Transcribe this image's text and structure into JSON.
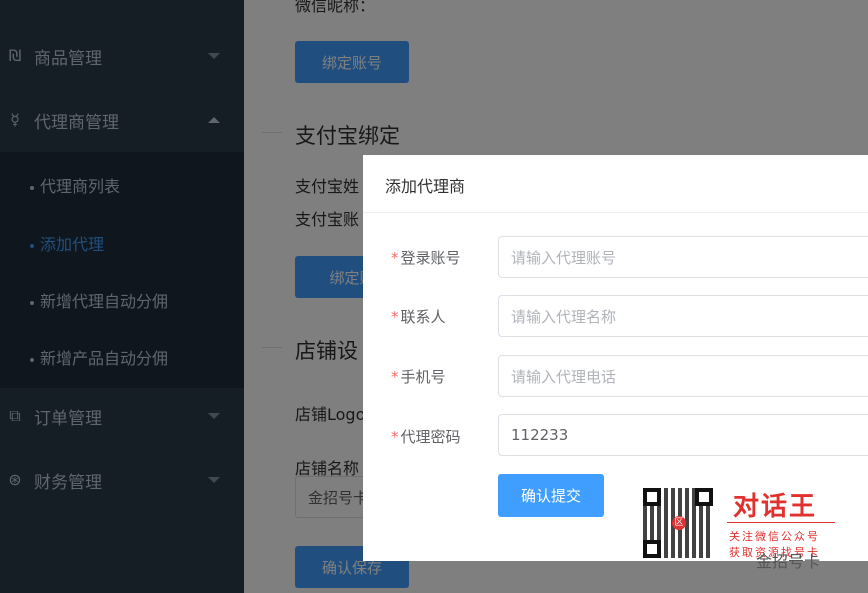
{
  "sidebar": {
    "menus": [
      {
        "label": "商品管理",
        "icon": "goods-icon"
      },
      {
        "label": "代理商管理",
        "icon": "agent-icon"
      },
      {
        "label": "订单管理",
        "icon": "order-icon"
      },
      {
        "label": "财务管理",
        "icon": "finance-icon"
      }
    ],
    "subitems": [
      {
        "label": "代理商列表"
      },
      {
        "label": "添加代理"
      },
      {
        "label": "新增代理自动分佣"
      },
      {
        "label": "新增产品自动分佣"
      }
    ]
  },
  "main": {
    "wechat_nickname_label": "微信昵称：",
    "bind_account_label": "绑定账号",
    "alipay_section_title": "支付宝绑定",
    "alipay_name_label": "支付宝姓",
    "alipay_account_label": "支付宝账",
    "alipay_bind_label": "绑定账",
    "store_section_title": "店铺设",
    "store_logo_label": "店铺Logo",
    "store_name_label": "店铺名称",
    "store_name_value": "金招号卡",
    "confirm_save_label": "确认保存"
  },
  "dialog": {
    "title": "添加代理商",
    "fields": [
      {
        "label": "登录账号",
        "placeholder": "请输入代理账号",
        "value": ""
      },
      {
        "label": "联系人",
        "placeholder": "请输入代理名称",
        "value": ""
      },
      {
        "label": "手机号",
        "placeholder": "请输入代理电话",
        "value": ""
      },
      {
        "label": "代理密码",
        "placeholder": "",
        "value": "112233"
      }
    ],
    "submit_label": "确认提交",
    "required_mark": "*"
  },
  "watermark": {
    "title": "对话王",
    "line1": "关注微信公众号",
    "line2": "获取资源找号卡",
    "footer": "金招号卡",
    "qr_center": "区"
  },
  "colors": {
    "sidebar_bg": "#2b3a4a",
    "submenu_bg": "#1f2d3d",
    "accent": "#409eff",
    "required": "#f56c6c",
    "watermark_red": "#e0312f"
  }
}
